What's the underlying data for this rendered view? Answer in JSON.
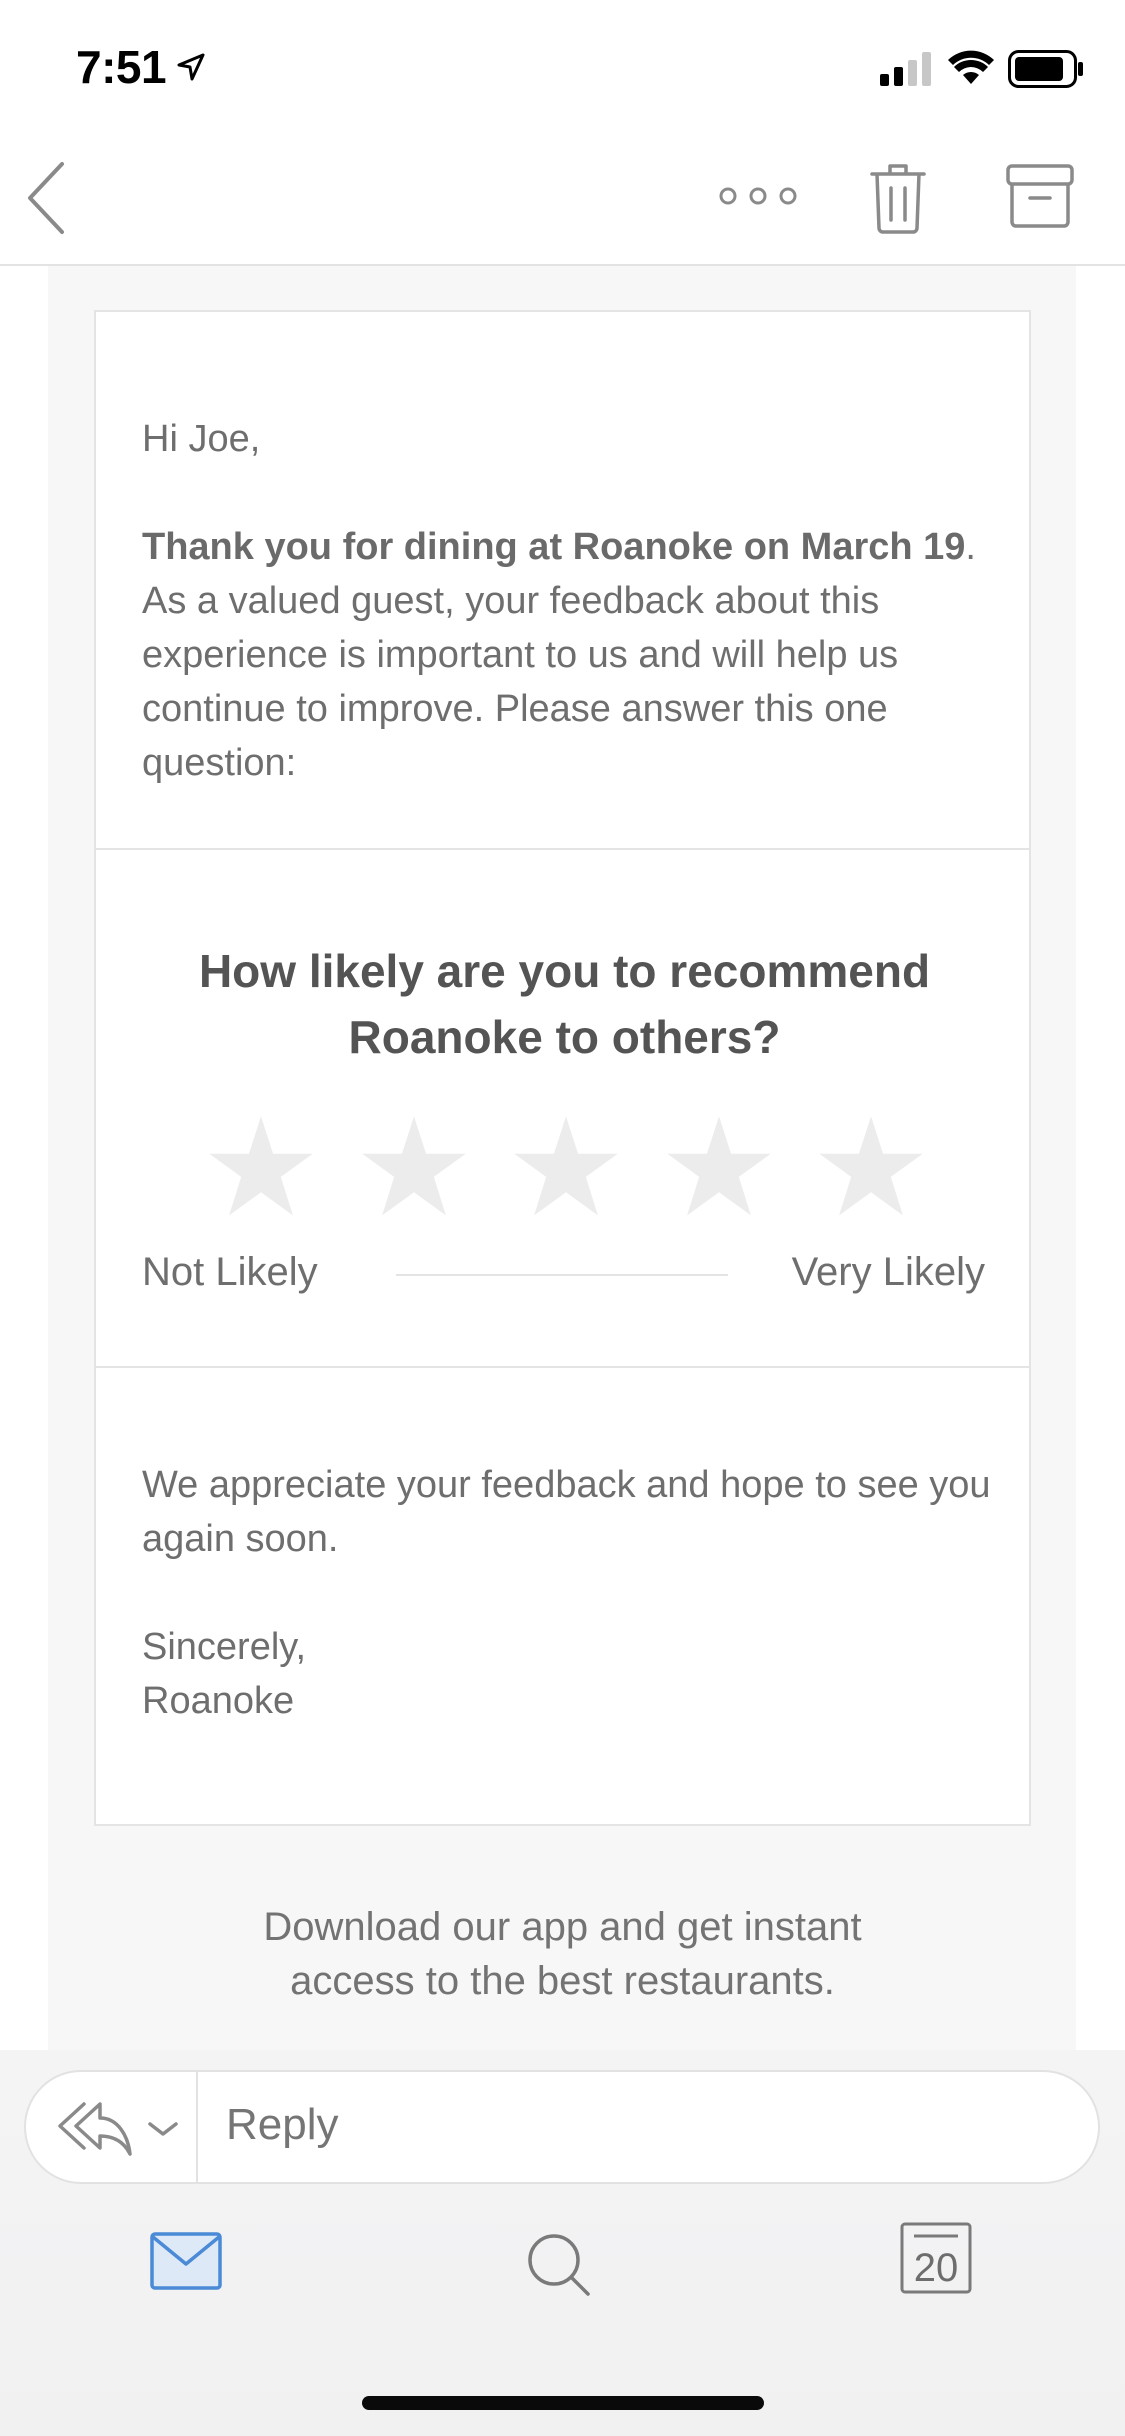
{
  "status_bar": {
    "time": "7:51"
  },
  "nav": {
    "icons": [
      "back-chevron-icon",
      "more-icon",
      "trash-icon",
      "archive-icon"
    ]
  },
  "email": {
    "greeting": "Hi Joe,",
    "intro_bold": "Thank you for dining at Roanoke on March 19",
    "intro_rest": ". As a valued guest, your feedback about this experience is important to us and will help us continue to improve. Please answer this one question:",
    "question": "How likely are you to recommend Roanoke to others?",
    "rating": {
      "selected": 0,
      "max": 5
    },
    "scale_low": "Not Likely",
    "scale_high": "Very Likely",
    "outro": "We appreciate your feedback and hope to see you again soon.",
    "signoff_1": "Sincerely,",
    "signoff_2": "Roanoke",
    "download_line1": "Download our app and get instant",
    "download_line2": "access to the best restaurants."
  },
  "reply": {
    "placeholder": "Reply"
  },
  "tabs": {
    "calendar_day": "20",
    "active": "mail"
  },
  "colors": {
    "accent": "#4a8ad6",
    "star_empty": "#ececec",
    "text": "#6e6e6e"
  }
}
